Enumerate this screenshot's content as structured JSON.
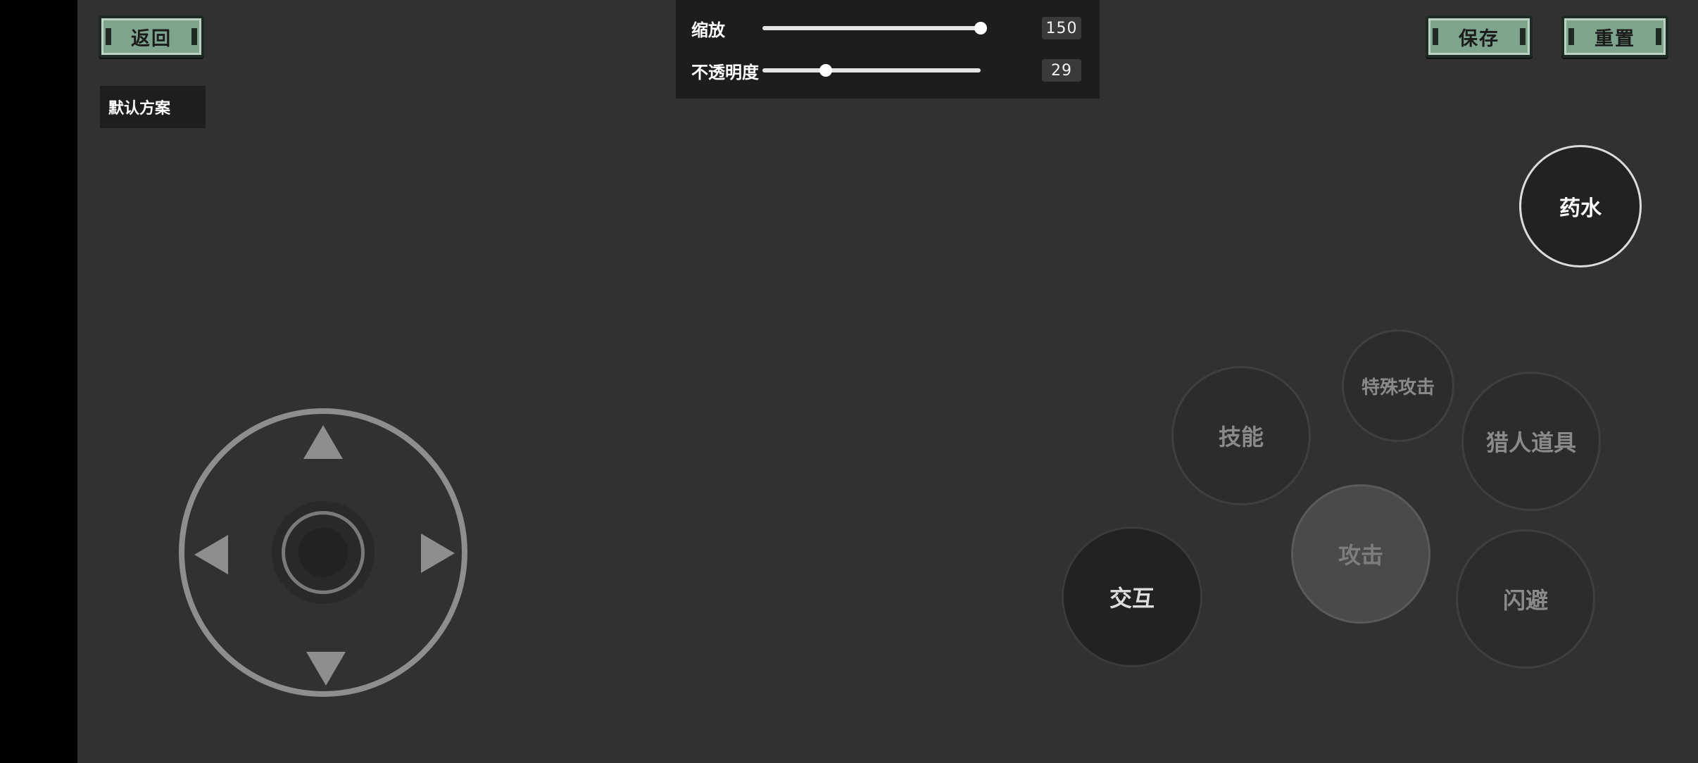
{
  "toolbar": {
    "back_label": "返回",
    "save_label": "保存",
    "reset_label": "重置"
  },
  "preset": {
    "name": "默认方案"
  },
  "settings": {
    "scale": {
      "label": "缩放",
      "value": "150",
      "fraction": 1.0
    },
    "opacity": {
      "label": "不透明度",
      "value": "29",
      "fraction": 0.29
    }
  },
  "controls": {
    "potion": "药水",
    "special_attack": "特殊攻击",
    "skill": "技能",
    "hunter_tool": "猎人道具",
    "attack": "攻击",
    "interact": "交互",
    "dodge": "闪避"
  },
  "colors": {
    "background": "#313131",
    "frame_button": "#7ea48e",
    "panel": "#1d1d1d"
  }
}
